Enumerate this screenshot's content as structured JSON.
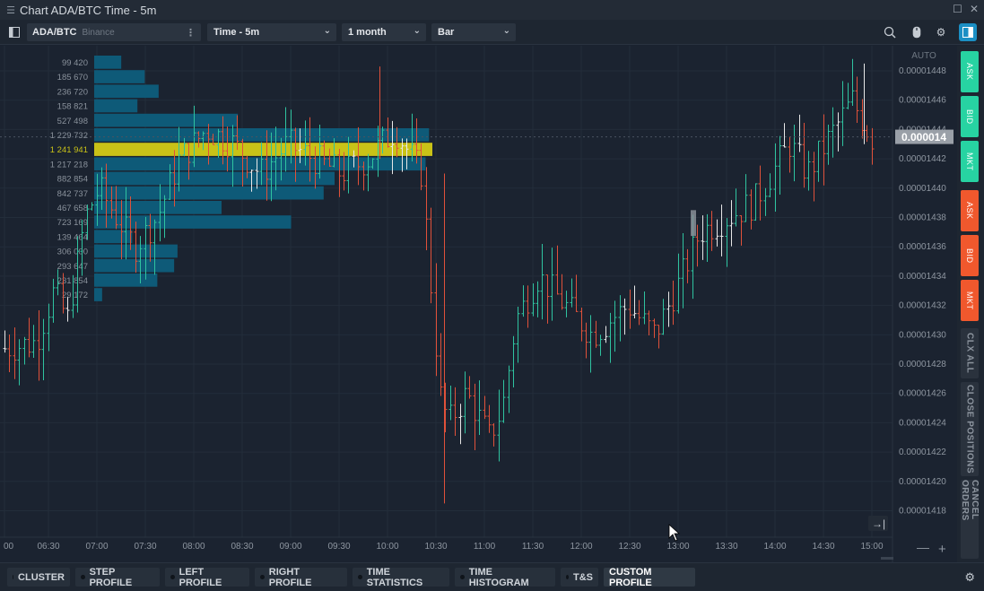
{
  "window": {
    "title": "Chart ADA/BTC Time - 5m"
  },
  "toolbar": {
    "symbol": "ADA/BTC",
    "exchange": "Binance",
    "timeframe": "Time - 5m",
    "period": "1 month",
    "chart_type": "Bar"
  },
  "right_panel": {
    "buy_ask": "ASK",
    "buy_bid": "BID",
    "buy_mkt": "MKT",
    "sell_ask": "ASK",
    "sell_bid": "BID",
    "sell_mkt": "MKT",
    "clear_all": "CLX ALL",
    "close_positions": "CLOSE POSITIONS",
    "cancel_orders": "CANCEL ORDERS",
    "buy_color": "#27d3a2",
    "sell_color": "#f0582d"
  },
  "bottom_tabs": [
    "CLUSTER",
    "STEP PROFILE",
    "LEFT PROFILE",
    "RIGHT PROFILE",
    "TIME STATISTICS",
    "TIME HISTOGRAM",
    "T&S",
    "CUSTOM PROFILE"
  ],
  "chart_data": {
    "type": "bar",
    "symbol": "ADA/BTC",
    "scale_mode": "AUTO",
    "current_price_label": "0.000014",
    "y_ticks": [
      "0.00001448",
      "0.00001446",
      "0.00001444",
      "0.00001442",
      "0.00001440",
      "0.00001438",
      "0.00001436",
      "0.00001434",
      "0.00001432",
      "0.00001430",
      "0.00001428",
      "0.00001426",
      "0.00001424",
      "0.00001422",
      "0.00001420",
      "0.00001418"
    ],
    "x_ticks": [
      "00",
      "06:30",
      "07:00",
      "07:30",
      "08:00",
      "08:30",
      "09:00",
      "09:30",
      "10:00",
      "10:30",
      "11:00",
      "11:30",
      "12:00",
      "12:30",
      "13:00",
      "13:30",
      "14:00",
      "14:30",
      "15:00"
    ],
    "volume_profile": [
      {
        "label": "99 420",
        "value": 99420
      },
      {
        "label": "185 670",
        "value": 185670
      },
      {
        "label": "236 720",
        "value": 236720
      },
      {
        "label": "158 821",
        "value": 158821
      },
      {
        "label": "527 498",
        "value": 527498
      },
      {
        "label": "1 229 732",
        "value": 1229732
      },
      {
        "label": "1 241 941",
        "value": 1241941,
        "poc": true
      },
      {
        "label": "1 217 218",
        "value": 1217218
      },
      {
        "label": "882 854",
        "value": 882854
      },
      {
        "label": "842 737",
        "value": 842737
      },
      {
        "label": "467 658",
        "value": 467658
      },
      {
        "label": "723 169",
        "value": 723169
      },
      {
        "label": "139 464",
        "value": 139464
      },
      {
        "label": "306 000",
        "value": 306000
      },
      {
        "label": "293 647",
        "value": 293647
      },
      {
        "label": "231 854",
        "value": 231854
      },
      {
        "label": "29 172",
        "value": 29172
      }
    ],
    "colors": {
      "up": "#2fc3a0",
      "down": "#e0513a",
      "profile": "#0e5a78",
      "poc": "#c9c217",
      "neutral": "#e8e8e8"
    }
  }
}
